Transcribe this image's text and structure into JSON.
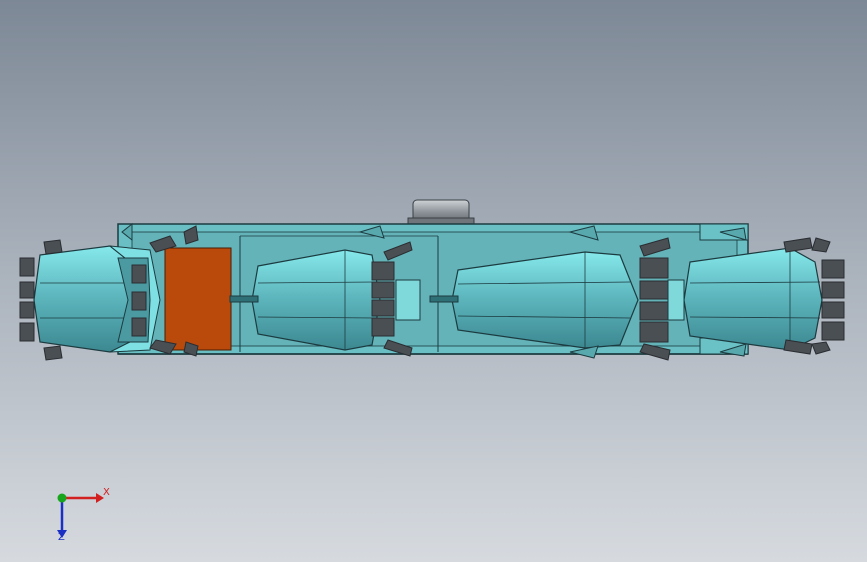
{
  "viewport": {
    "background_top": "#7d8896",
    "background_bottom": "#d6dadf"
  },
  "model": {
    "colors": {
      "body_light": "#7fe6e8",
      "body_mid": "#5fb8bf",
      "body_dark": "#3f8d96",
      "frame": "#69bfc3",
      "edge": "#1c3b40",
      "panel": "#b94a0b",
      "cutter": "#4a4f54",
      "cutter_dark": "#2a2d31",
      "motor": "#9aa0a6"
    }
  },
  "triad": {
    "x_label": "X",
    "z_label": "Z",
    "x_color": "#d22020",
    "y_color": "#17a51d",
    "z_color": "#1b2fc4"
  }
}
